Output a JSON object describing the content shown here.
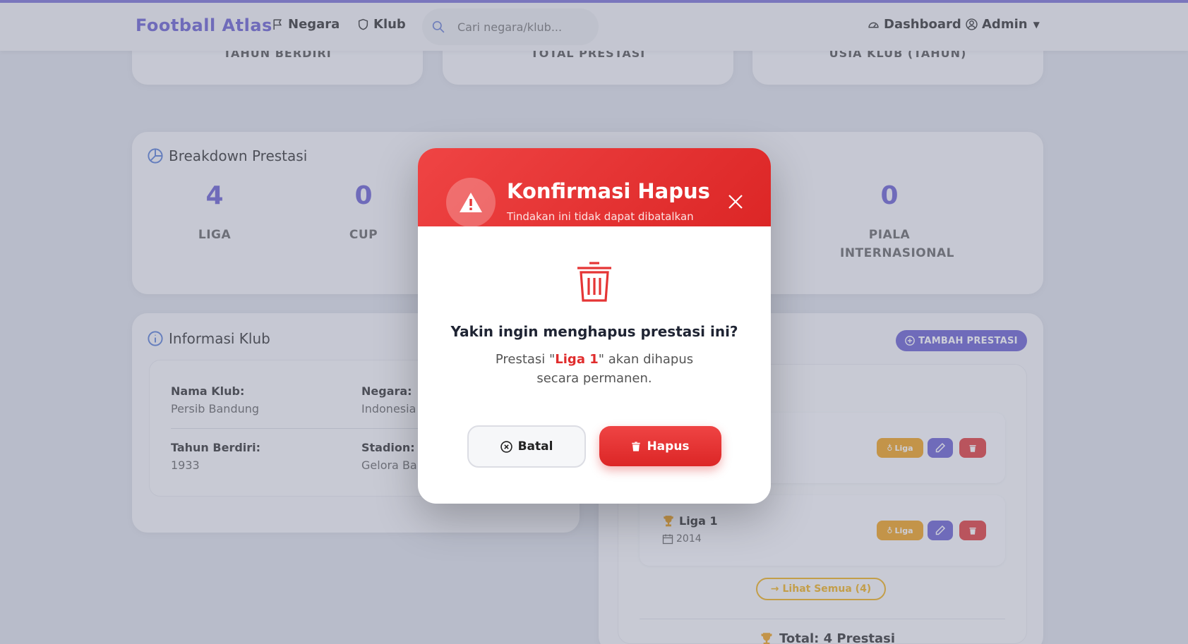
{
  "navbar": {
    "brand": "Football Atlas",
    "links": [
      {
        "label": "Negara",
        "icon": "flag-icon"
      },
      {
        "label": "Klub",
        "icon": "shield-icon"
      }
    ],
    "search_placeholder": "Cari negara/klub...",
    "dashboard_label": "Dashboard",
    "user_label": "Admin"
  },
  "stats": {
    "labels": [
      "TAHUN BERDIRI",
      "TOTAL PRESTASI",
      "USIA KLUB (TAHUN)"
    ]
  },
  "breakdown": {
    "title": "Breakdown Prestasi",
    "items": [
      {
        "value": "4",
        "label": "LIGA"
      },
      {
        "value": "0",
        "label": "CUP"
      },
      {
        "value": "0",
        "label": "PIALA INTERNASIONAL"
      }
    ]
  },
  "info": {
    "title": "Informasi Klub",
    "fields": [
      {
        "key": "Nama Klub:",
        "value": "Persib Bandung"
      },
      {
        "key": "Negara:",
        "value": "Indonesia"
      },
      {
        "key": "Tahun Berdiri:",
        "value": "1933"
      },
      {
        "key": "Stadion:",
        "value": "Gelora Ba"
      }
    ]
  },
  "achievements": {
    "add_button": "TAMBAH PRESTASI",
    "items": [
      {
        "title": "",
        "year": "",
        "type": "Liga"
      },
      {
        "title": "Liga 1",
        "year": "2014",
        "type": "Liga"
      }
    ],
    "see_all": "Lihat Semua (4)",
    "total": "Total: 4 Prestasi"
  },
  "modal": {
    "title": "Konfirmasi Hapus",
    "subtitle": "Tindakan ini tidak dapat dibatalkan",
    "question": "Yakin ingin menghapus prestasi ini?",
    "desc_prefix": "Prestasi \"",
    "desc_item": "Liga 1",
    "desc_suffix": "\" akan dihapus secara permanen.",
    "cancel_label": "Batal",
    "delete_label": "Hapus"
  },
  "colors": {
    "brand": "#6a5fd0",
    "danger": "#dc2626",
    "warning": "#f0a21b"
  }
}
